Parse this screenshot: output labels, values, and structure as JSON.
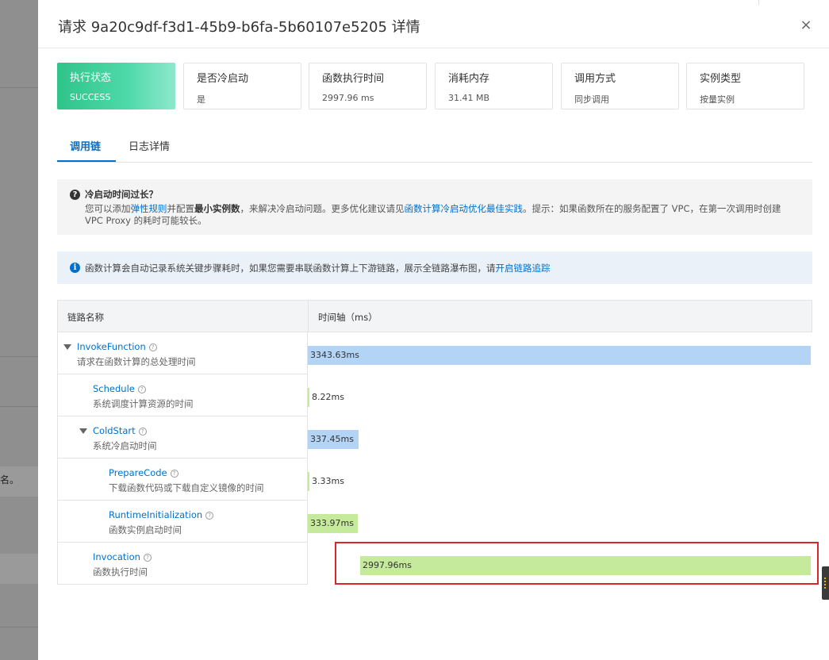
{
  "drawer": {
    "title": "请求 9a20c9df-f3d1-45b9-b6fa-5b60107e5205 详情",
    "close_glyph": "×"
  },
  "stats": [
    {
      "label": "执行状态",
      "value": "SUCCESS"
    },
    {
      "label": "是否冷启动",
      "value": "是"
    },
    {
      "label": "函数执行时间",
      "value": "2997.96 ms"
    },
    {
      "label": "消耗内存",
      "value": "31.41 MB"
    },
    {
      "label": "调用方式",
      "value": "同步调用"
    },
    {
      "label": "实例类型",
      "value": "按量实例"
    }
  ],
  "tabs": [
    {
      "label": "调用链",
      "active": true
    },
    {
      "label": "日志详情",
      "active": false
    }
  ],
  "notice": {
    "title": "冷启动时间过长？",
    "body_1": "您可以添加",
    "link_1": "弹性规则",
    "body_2": "并配置",
    "bold_1": "最小实例数",
    "body_3": "，来解决冷启动问题。更多优化建议请见",
    "link_2": "函数计算冷启动优化最佳实践",
    "body_4": "。提示：如果函数所在的服务配置了 VPC，在第一次调用时创建 VPC Proxy 的耗时可能较长。"
  },
  "info": {
    "text": "函数计算会自动记录系统关键步骤耗时，如果您需要串联函数计算上下游链路，展示全链路瀑布图，请",
    "link": "开启链路追踪"
  },
  "trace": {
    "header_name": "链路名称",
    "header_timeline": "时间轴（ms）",
    "total_ms": 3343.63,
    "rows": [
      {
        "name": "InvokeFunction",
        "desc": "请求在函数计算的总处理时间",
        "duration": "3343.63ms",
        "duration_ms": 3343.63,
        "start_ms": 0,
        "color": "blue",
        "depth": 0,
        "expandable": true
      },
      {
        "name": "Schedule",
        "desc": "系统调度计算资源的时间",
        "duration": "8.22ms",
        "duration_ms": 8.22,
        "start_ms": 0,
        "color": "green",
        "depth": 1,
        "expandable": false
      },
      {
        "name": "ColdStart",
        "desc": "系统冷启动时间",
        "duration": "337.45ms",
        "duration_ms": 337.45,
        "start_ms": 0,
        "color": "blue",
        "depth": 1,
        "expandable": true
      },
      {
        "name": "PrepareCode",
        "desc": "下载函数代码或下载自定义镜像的时间",
        "duration": "3.33ms",
        "duration_ms": 3.33,
        "start_ms": 0,
        "color": "green",
        "depth": 2,
        "expandable": false
      },
      {
        "name": "RuntimeInitialization",
        "desc": "函数实例启动时间",
        "duration": "333.97ms",
        "duration_ms": 333.97,
        "start_ms": 0,
        "color": "green",
        "depth": 2,
        "expandable": false
      },
      {
        "name": "Invocation",
        "desc": "函数执行时间",
        "duration": "2997.96ms",
        "duration_ms": 2997.96,
        "start_ms": 345.67,
        "color": "green",
        "depth": 1,
        "expandable": false
      }
    ]
  },
  "colors": {
    "accent": "#0070cc",
    "success_card": "#2fc48a",
    "bar_blue": "#b3d4f5",
    "bar_green": "#c6ea9b",
    "highlight": "#d9262b"
  },
  "background_page": {
    "visible_glyph": "名。"
  }
}
